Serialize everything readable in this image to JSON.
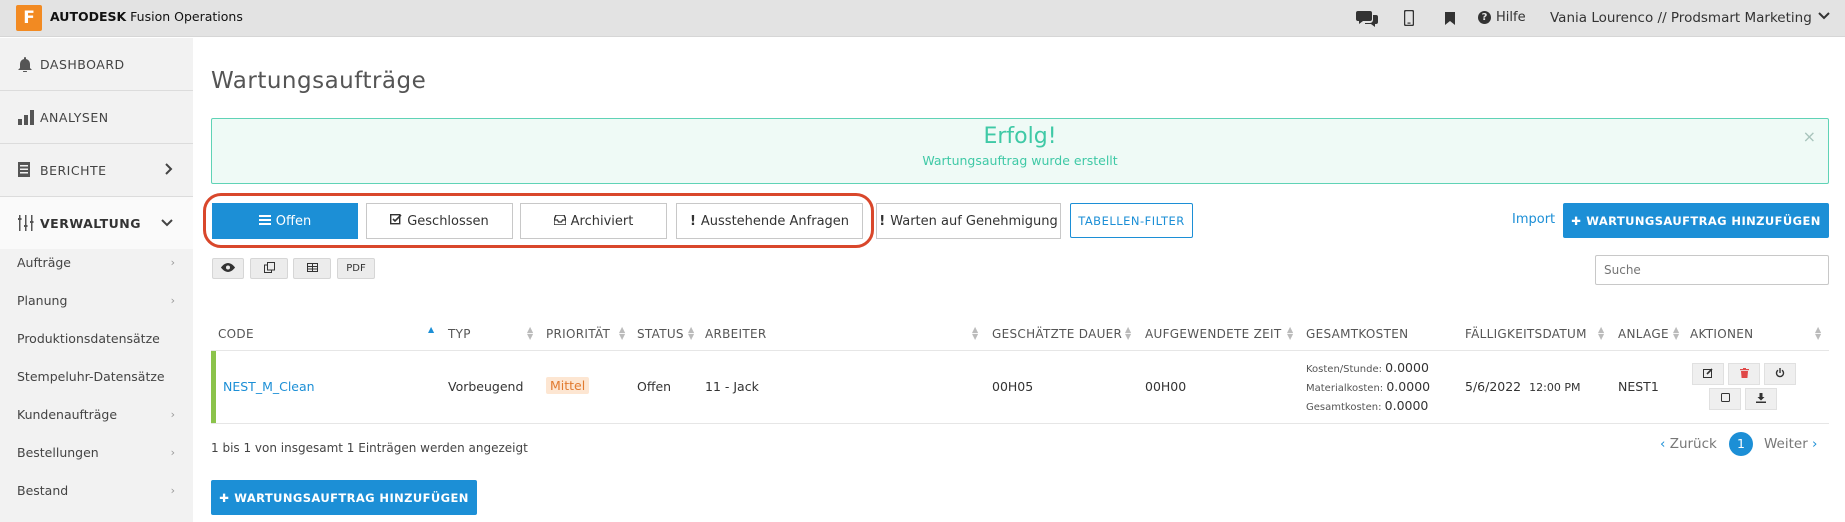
{
  "app": {
    "logo_letter": "F",
    "brand_bold": "AUTODESK",
    "brand_rest": " Fusion Operations",
    "help_label": "Hilfe",
    "user_label": "Vania Lourenco // Prodsmart Marketing",
    "accent_color": "#1c8fd6",
    "brand_color": "#f28a22"
  },
  "sidebar": {
    "main": [
      {
        "label": "DASHBOARD",
        "icon": "bell-icon"
      },
      {
        "label": "ANALYSEN",
        "icon": "bar-chart-icon"
      },
      {
        "label": "BERICHTE",
        "icon": "document-icon"
      },
      {
        "label": "VERWALTUNG",
        "icon": "sliders-icon"
      }
    ],
    "sub": [
      {
        "label": "Aufträge",
        "chevron": true
      },
      {
        "label": "Planung",
        "chevron": true
      },
      {
        "label": "Produktionsdatensätze",
        "chevron": false
      },
      {
        "label": "Stempeluhr-Datensätze",
        "chevron": false
      },
      {
        "label": "Kundenaufträge",
        "chevron": true
      },
      {
        "label": "Bestellungen",
        "chevron": true
      },
      {
        "label": "Bestand",
        "chevron": true
      }
    ]
  },
  "page": {
    "title": "Wartungsaufträge"
  },
  "alert": {
    "title": "Erfolg!",
    "message": "Wartungsauftrag wurde erstellt",
    "close": "×"
  },
  "filters": {
    "open": "Offen",
    "closed": "Geschlossen",
    "archived": "Archiviert",
    "pending": "Ausstehende Anfragen",
    "awaiting": "Warten auf Genehmigung",
    "table_filter": "TABELLEN-FILTER",
    "import": "Import",
    "add_top": "WARTUNGSAUFTRAG HINZUFÜGEN",
    "add_bottom": "WARTUNGSAUFTRAG HINZUFÜGEN"
  },
  "toolbar": {
    "pdf": "PDF",
    "search_placeholder": "Suche"
  },
  "table": {
    "headers": {
      "code": "CODE",
      "typ": "TYP",
      "prioritaet": "PRIORITÄT",
      "status": "STATUS",
      "arbeiter": "ARBEITER",
      "dauer": "GESCHÄTZTE DAUER",
      "zeit": "AUFGEWENDETE ZEIT",
      "kosten": "GESAMTKOSTEN",
      "datum": "FÄLLIGKEITSDATUM",
      "anlage": "ANLAGE",
      "aktionen": "AKTIONEN"
    },
    "rows": [
      {
        "code": "NEST_M_Clean",
        "typ": "Vorbeugend",
        "prioritaet": "Mittel",
        "status": "Offen",
        "arbeiter": "11 - Jack",
        "dauer": "00H05",
        "zeit": "00H00",
        "kosten_stunde_label": "Kosten/Stunde:",
        "kosten_stunde": "0.0000",
        "material_label": "Materialkosten:",
        "material": "0.0000",
        "gesamt_label": "Gesamtkosten:",
        "gesamt": "0.0000",
        "datum": "5/6/2022",
        "zeit_uhr": "12:00 PM",
        "anlage": "NEST1"
      }
    ]
  },
  "footer": {
    "info": "1 bis 1 von insgesamt 1 Einträgen werden angezeigt",
    "prev": "Zurück",
    "page": "1",
    "next": "Weiter"
  }
}
